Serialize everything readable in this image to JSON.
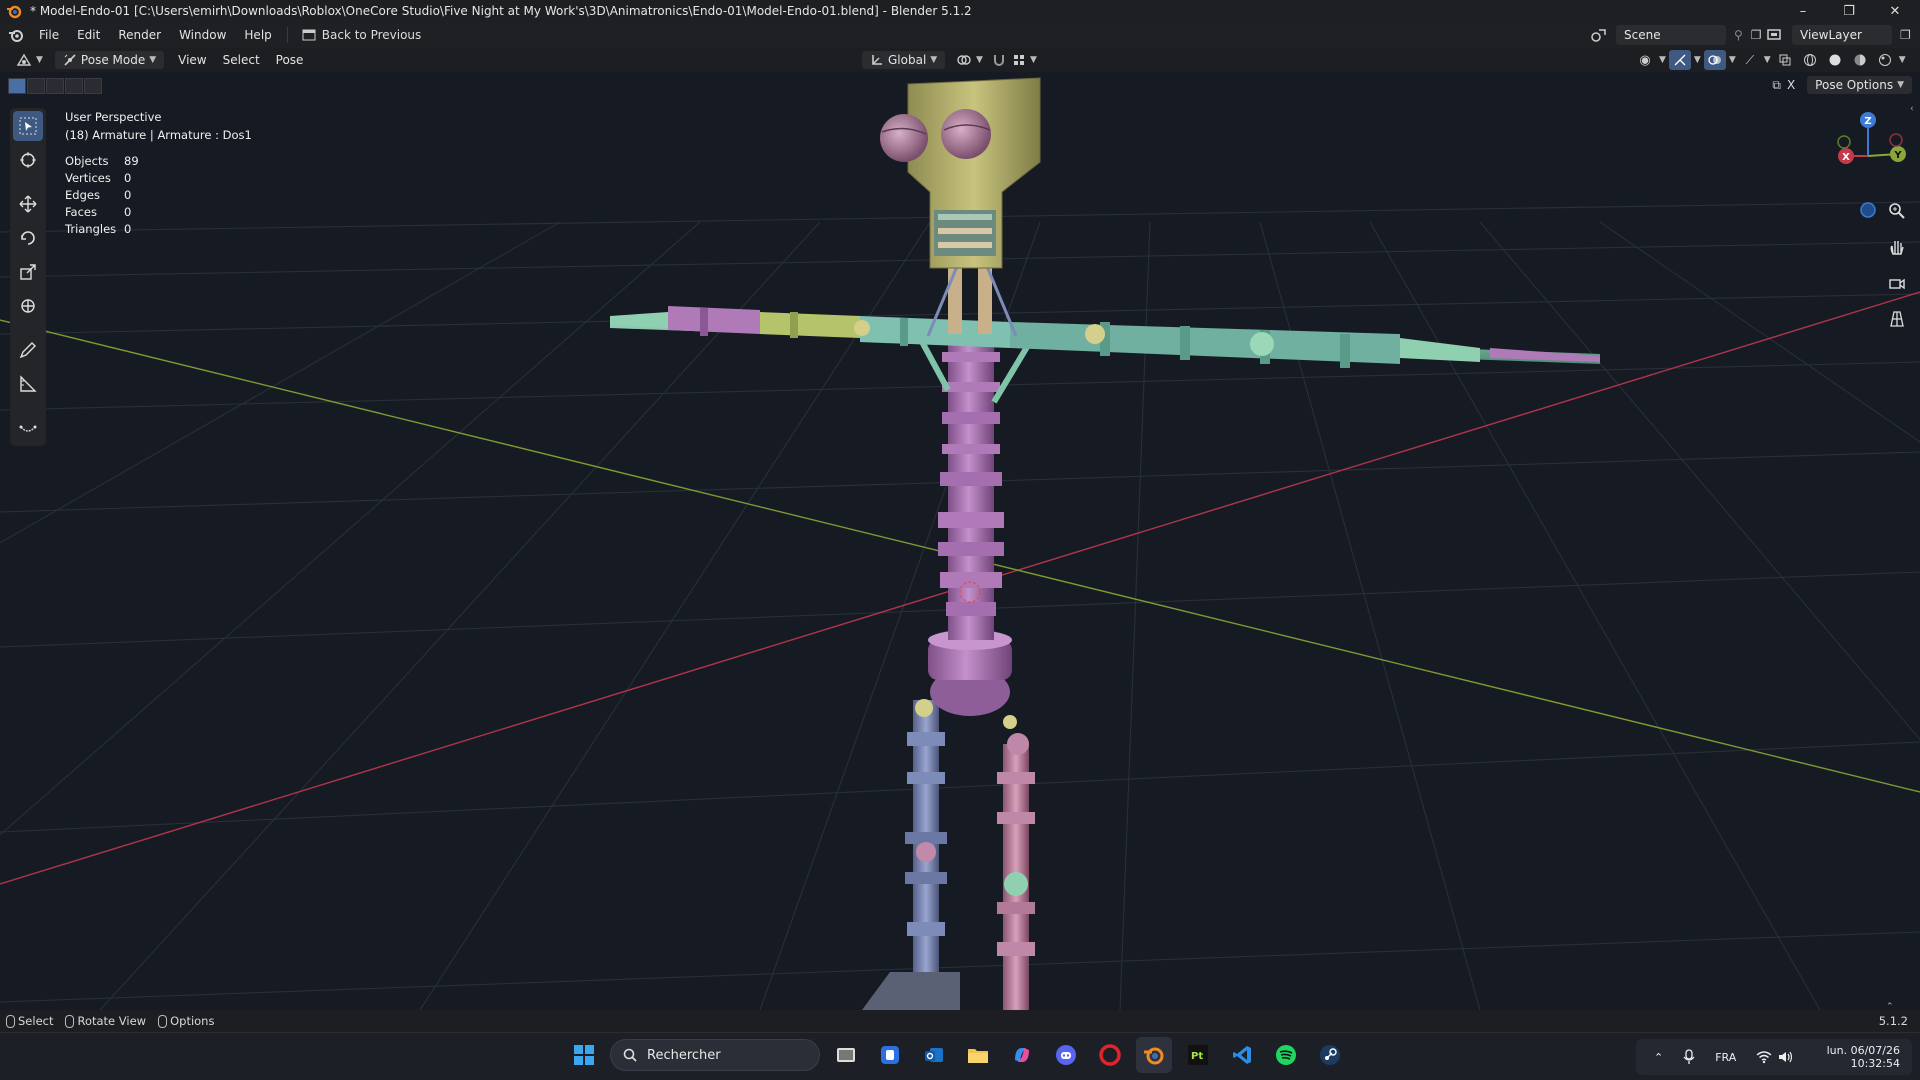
{
  "window": {
    "title": "* Model-Endo-01 [C:\\Users\\emirh\\Downloads\\Roblox\\OneCore Studio\\Five Night at My Work's\\3D\\Animatronics\\Endo-01\\Model-Endo-01.blend] - Blender 5.1.2",
    "minimize": "–",
    "restore": "❐",
    "close": "✕"
  },
  "menu": {
    "items": [
      "File",
      "Edit",
      "Render",
      "Window",
      "Help"
    ],
    "back_label": "Back to Previous",
    "scene": "Scene",
    "view_layer": "ViewLayer"
  },
  "header": {
    "mode": "Pose Mode",
    "items": [
      "View",
      "Select",
      "Pose"
    ],
    "orientation": "Global",
    "close_x": "X",
    "pose_options": "Pose Options"
  },
  "viewport": {
    "perspective": "User Perspective",
    "object_info": "(18) Armature | Armature : Dos1",
    "stats": [
      {
        "label": "Objects",
        "value": "89"
      },
      {
        "label": "Vertices",
        "value": "0"
      },
      {
        "label": "Edges",
        "value": "0"
      },
      {
        "label": "Faces",
        "value": "0"
      },
      {
        "label": "Triangles",
        "value": "0"
      }
    ],
    "gizmo": {
      "x": "X",
      "y": "Y",
      "z": "Z"
    }
  },
  "statusbar": {
    "select": "Select",
    "rotate": "Rotate View",
    "options": "Options",
    "version": "5.1.2"
  },
  "taskbar": {
    "search_placeholder": "Rechercher",
    "language": "FRA",
    "date": "lun. 06/07/26",
    "time": "10:32:54"
  },
  "colors": {
    "accent": "#3f5a82",
    "x_axis": "#c43a4a",
    "y_axis": "#8aa83a",
    "z_axis": "#3d7ad6",
    "head": "#b5b06a",
    "torso": "#b07ab8",
    "arm": "#7fc4a8",
    "leg_left": "#7d8bb8",
    "leg_right": "#c088a8"
  }
}
